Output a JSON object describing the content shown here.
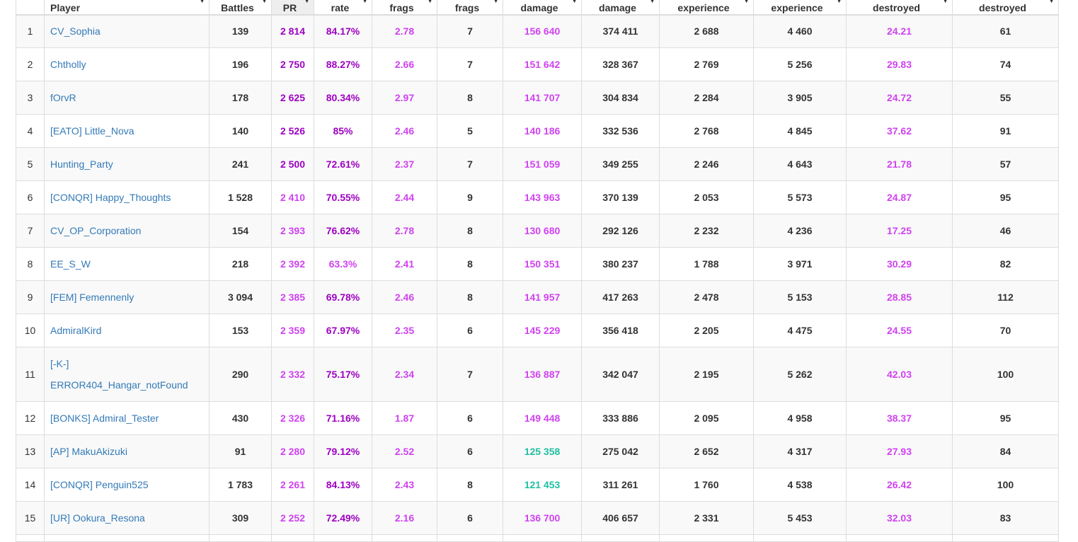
{
  "colors": {
    "magenta": "#d042f0",
    "purple": "#9d00c2",
    "teal": "#1fbfa3",
    "dark": "#333333",
    "link": "#337ab7"
  },
  "headers": [
    {
      "label": "Player",
      "align": "left"
    },
    {
      "label": "Battles"
    },
    {
      "label": "PR",
      "sorted": true
    },
    {
      "label": "rate"
    },
    {
      "label": "frags"
    },
    {
      "label": "frags"
    },
    {
      "label": "damage"
    },
    {
      "label": "damage"
    },
    {
      "label": "experience"
    },
    {
      "label": "experience"
    },
    {
      "label": "destroyed"
    },
    {
      "label": "destroyed"
    }
  ],
  "rows": [
    {
      "rank": "1",
      "player": "CV_Sophia",
      "battles": "139",
      "pr": "2 814",
      "winrate": "84.17%",
      "avg_frags": "2.78",
      "max_frags": "7",
      "avg_damage": "156 640",
      "max_damage": "374 411",
      "avg_exp": "2 688",
      "max_exp": "4 460",
      "avg_destroyed": "24.21",
      "max_destroyed": "61",
      "c": {
        "pr": "purple",
        "winrate": "purple",
        "avg_frags": "magenta",
        "avg_damage": "magenta",
        "avg_destroyed": "magenta"
      }
    },
    {
      "rank": "2",
      "player": "Chtholly",
      "battles": "196",
      "pr": "2 750",
      "winrate": "88.27%",
      "avg_frags": "2.66",
      "max_frags": "7",
      "avg_damage": "151 642",
      "max_damage": "328 367",
      "avg_exp": "2 769",
      "max_exp": "5 256",
      "avg_destroyed": "29.83",
      "max_destroyed": "74",
      "c": {
        "pr": "purple",
        "winrate": "purple",
        "avg_frags": "magenta",
        "avg_damage": "magenta",
        "avg_destroyed": "magenta"
      }
    },
    {
      "rank": "3",
      "player": "fOrvR",
      "battles": "178",
      "pr": "2 625",
      "winrate": "80.34%",
      "avg_frags": "2.97",
      "max_frags": "8",
      "avg_damage": "141 707",
      "max_damage": "304 834",
      "avg_exp": "2 284",
      "max_exp": "3 905",
      "avg_destroyed": "24.72",
      "max_destroyed": "55",
      "c": {
        "pr": "purple",
        "winrate": "purple",
        "avg_frags": "magenta",
        "avg_damage": "magenta",
        "avg_destroyed": "magenta"
      }
    },
    {
      "rank": "4",
      "player": "[EATO] Little_Nova",
      "battles": "140",
      "pr": "2 526",
      "winrate": "85%",
      "avg_frags": "2.46",
      "max_frags": "5",
      "avg_damage": "140 186",
      "max_damage": "332 536",
      "avg_exp": "2 768",
      "max_exp": "4 845",
      "avg_destroyed": "37.62",
      "max_destroyed": "91",
      "c": {
        "pr": "purple",
        "winrate": "purple",
        "avg_frags": "magenta",
        "avg_damage": "magenta",
        "avg_destroyed": "magenta"
      }
    },
    {
      "rank": "5",
      "player": "Hunting_Party",
      "battles": "241",
      "pr": "2 500",
      "winrate": "72.61%",
      "avg_frags": "2.37",
      "max_frags": "7",
      "avg_damage": "151 059",
      "max_damage": "349 255",
      "avg_exp": "2 246",
      "max_exp": "4 643",
      "avg_destroyed": "21.78",
      "max_destroyed": "57",
      "c": {
        "pr": "purple",
        "winrate": "purple",
        "avg_frags": "magenta",
        "avg_damage": "magenta",
        "avg_destroyed": "magenta"
      }
    },
    {
      "rank": "6",
      "player": "[CONQR] Happy_Thoughts",
      "battles": "1 528",
      "pr": "2 410",
      "winrate": "70.55%",
      "avg_frags": "2.44",
      "max_frags": "9",
      "avg_damage": "143 963",
      "max_damage": "370 139",
      "avg_exp": "2 053",
      "max_exp": "5 573",
      "avg_destroyed": "24.87",
      "max_destroyed": "95",
      "c": {
        "pr": "magenta",
        "winrate": "purple",
        "avg_frags": "magenta",
        "avg_damage": "magenta",
        "avg_destroyed": "magenta"
      }
    },
    {
      "rank": "7",
      "player": "CV_OP_Corporation",
      "battles": "154",
      "pr": "2 393",
      "winrate": "76.62%",
      "avg_frags": "2.78",
      "max_frags": "8",
      "avg_damage": "130 680",
      "max_damage": "292 126",
      "avg_exp": "2 232",
      "max_exp": "4 236",
      "avg_destroyed": "17.25",
      "max_destroyed": "46",
      "c": {
        "pr": "magenta",
        "winrate": "purple",
        "avg_frags": "magenta",
        "avg_damage": "magenta",
        "avg_destroyed": "magenta"
      }
    },
    {
      "rank": "8",
      "player": "EE_S_W",
      "battles": "218",
      "pr": "2 392",
      "winrate": "63.3%",
      "avg_frags": "2.41",
      "max_frags": "8",
      "avg_damage": "150 351",
      "max_damage": "380 237",
      "avg_exp": "1 788",
      "max_exp": "3 971",
      "avg_destroyed": "30.29",
      "max_destroyed": "82",
      "c": {
        "pr": "magenta",
        "winrate": "magenta",
        "avg_frags": "magenta",
        "avg_damage": "magenta",
        "avg_destroyed": "magenta"
      }
    },
    {
      "rank": "9",
      "player": "[FEM] Femennenly",
      "battles": "3 094",
      "pr": "2 385",
      "winrate": "69.78%",
      "avg_frags": "2.46",
      "max_frags": "8",
      "avg_damage": "141 957",
      "max_damage": "417 263",
      "avg_exp": "2 478",
      "max_exp": "5 153",
      "avg_destroyed": "28.85",
      "max_destroyed": "112",
      "c": {
        "pr": "magenta",
        "winrate": "purple",
        "avg_frags": "magenta",
        "avg_damage": "magenta",
        "avg_destroyed": "magenta"
      }
    },
    {
      "rank": "10",
      "player": "AdmiralKird",
      "battles": "153",
      "pr": "2 359",
      "winrate": "67.97%",
      "avg_frags": "2.35",
      "max_frags": "6",
      "avg_damage": "145 229",
      "max_damage": "356 418",
      "avg_exp": "2 205",
      "max_exp": "4 475",
      "avg_destroyed": "24.55",
      "max_destroyed": "70",
      "c": {
        "pr": "magenta",
        "winrate": "purple",
        "avg_frags": "magenta",
        "avg_damage": "magenta",
        "avg_destroyed": "magenta"
      }
    },
    {
      "rank": "11",
      "player": "[-K-] ERROR404_Hangar_notFound",
      "battles": "290",
      "pr": "2 332",
      "winrate": "75.17%",
      "avg_frags": "2.34",
      "max_frags": "7",
      "avg_damage": "136 887",
      "max_damage": "342 047",
      "avg_exp": "2 195",
      "max_exp": "5 262",
      "avg_destroyed": "42.03",
      "max_destroyed": "100",
      "c": {
        "pr": "magenta",
        "winrate": "purple",
        "avg_frags": "magenta",
        "avg_damage": "magenta",
        "avg_destroyed": "magenta"
      }
    },
    {
      "rank": "12",
      "player": "[BONKS] Admiral_Tester",
      "battles": "430",
      "pr": "2 326",
      "winrate": "71.16%",
      "avg_frags": "1.87",
      "max_frags": "6",
      "avg_damage": "149 448",
      "max_damage": "333 886",
      "avg_exp": "2 095",
      "max_exp": "4 958",
      "avg_destroyed": "38.37",
      "max_destroyed": "95",
      "c": {
        "pr": "magenta",
        "winrate": "purple",
        "avg_frags": "magenta",
        "avg_damage": "magenta",
        "avg_destroyed": "magenta"
      }
    },
    {
      "rank": "13",
      "player": "[AP] MakuAkizuki",
      "battles": "91",
      "pr": "2 280",
      "winrate": "79.12%",
      "avg_frags": "2.52",
      "max_frags": "6",
      "avg_damage": "125 358",
      "max_damage": "275 042",
      "avg_exp": "2 652",
      "max_exp": "4 317",
      "avg_destroyed": "27.93",
      "max_destroyed": "84",
      "c": {
        "pr": "magenta",
        "winrate": "purple",
        "avg_frags": "magenta",
        "avg_damage": "teal",
        "avg_destroyed": "magenta"
      }
    },
    {
      "rank": "14",
      "player": "[CONQR] Penguin525",
      "battles": "1 783",
      "pr": "2 261",
      "winrate": "84.13%",
      "avg_frags": "2.43",
      "max_frags": "8",
      "avg_damage": "121 453",
      "max_damage": "311 261",
      "avg_exp": "1 760",
      "max_exp": "4 538",
      "avg_destroyed": "26.42",
      "max_destroyed": "100",
      "c": {
        "pr": "magenta",
        "winrate": "purple",
        "avg_frags": "magenta",
        "avg_damage": "teal",
        "avg_destroyed": "magenta"
      }
    },
    {
      "rank": "15",
      "player": "[UR] Ookura_Resona",
      "battles": "309",
      "pr": "2 252",
      "winrate": "72.49%",
      "avg_frags": "2.16",
      "max_frags": "6",
      "avg_damage": "136 700",
      "max_damage": "406 657",
      "avg_exp": "2 331",
      "max_exp": "5 453",
      "avg_destroyed": "32.03",
      "max_destroyed": "83",
      "c": {
        "pr": "magenta",
        "winrate": "purple",
        "avg_frags": "magenta",
        "avg_damage": "magenta",
        "avg_destroyed": "magenta"
      }
    }
  ]
}
